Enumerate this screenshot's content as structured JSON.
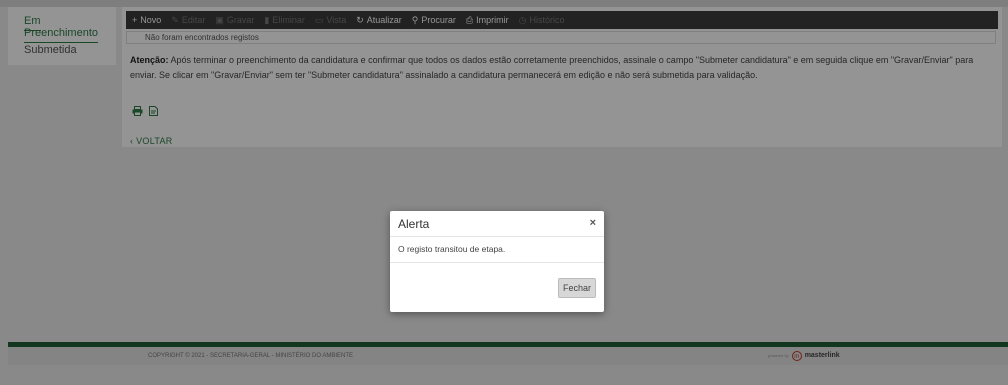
{
  "sidebar": {
    "items": [
      {
        "label": "Em Preenchimento",
        "active": true
      },
      {
        "label": "Submetida",
        "active": false
      }
    ]
  },
  "toolbar": {
    "items": [
      {
        "label": "Novo",
        "icon": "plus-icon",
        "glyph": "+",
        "enabled": true
      },
      {
        "label": "Editar",
        "icon": "pencil-icon",
        "glyph": "✎",
        "enabled": false
      },
      {
        "label": "Gravar",
        "icon": "save-icon",
        "glyph": "▣",
        "enabled": false
      },
      {
        "label": "Eliminar",
        "icon": "trash-icon",
        "glyph": "▮",
        "enabled": false
      },
      {
        "label": "Vista",
        "icon": "view-icon",
        "glyph": "▭",
        "enabled": false
      },
      {
        "label": "Atualizar",
        "icon": "refresh-icon",
        "glyph": "↻",
        "enabled": true
      },
      {
        "label": "Procurar",
        "icon": "search-icon",
        "glyph": "⚲",
        "enabled": true
      },
      {
        "label": "Imprimir",
        "icon": "print-icon",
        "glyph": "⎙",
        "enabled": true
      },
      {
        "label": "Histórico",
        "icon": "history-icon",
        "glyph": "◷",
        "enabled": false
      }
    ]
  },
  "notice": "Não foram encontrados registos",
  "instructions": {
    "label": "Atenção:",
    "text": " Após terminar o preenchimento da candidatura e confirmar que todos os dados estão corretamente preenchidos, assinale o campo \"Submeter candidatura\" e em seguida clique em \"Gravar/Enviar\" para enviar. Se clicar em \"Gravar/Enviar\" sem ter \"Submeter candidatura\" assinalado a candidatura permanecerá em edição e não será submetida para validação."
  },
  "icons": {
    "print": "print-icon",
    "pdf": "pdf-icon"
  },
  "back": "VOLTAR",
  "modal": {
    "title": "Alerta",
    "close": "×",
    "message": "O registo transitou de etapa.",
    "button": "Fechar"
  },
  "footer": {
    "copyright": "COPYRIGHT © 2021 - SECRETARIA-GERAL - MINISTÉRIO DO AMBIENTE",
    "powered": "powered by",
    "brand": "masterlink"
  },
  "colors": {
    "accent": "#2f7a47",
    "toolbar": "#3b3b3b",
    "footer_bar": "#1f5f34"
  }
}
